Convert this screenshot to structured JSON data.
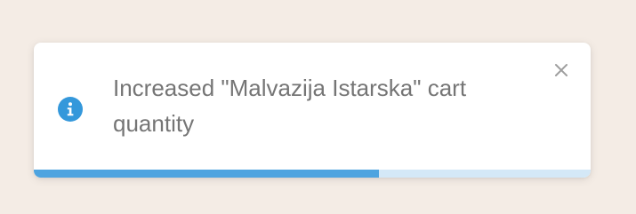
{
  "background_color": "#f4ece5",
  "toast": {
    "type": "info",
    "icon": "info-icon",
    "message": "Increased \"Malvazija Istarska\" cart quantity",
    "close_icon": "close-icon",
    "progress": 0.62,
    "accent_color": "#3498db",
    "progress_color": "#4ea4e0",
    "progress_track_color": "#d4e8f7"
  }
}
